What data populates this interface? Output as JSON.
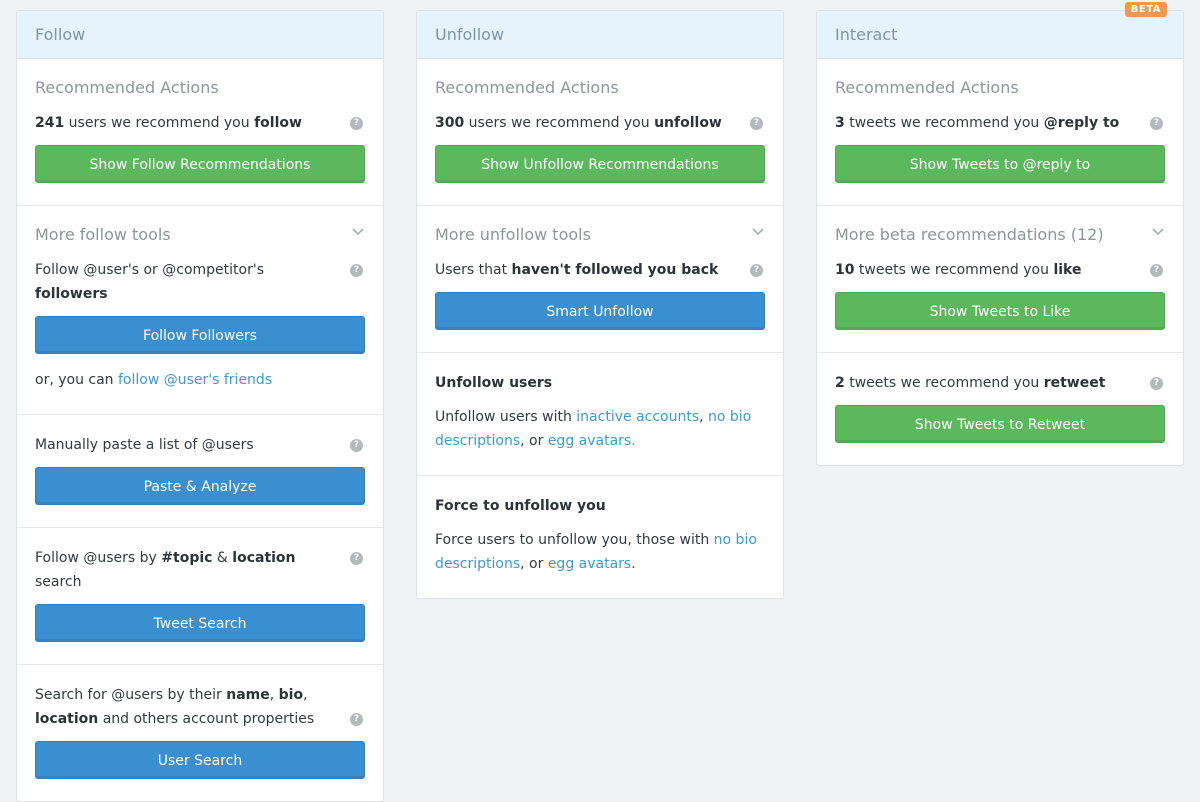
{
  "follow": {
    "header": "Follow",
    "recommended_title": "Recommended Actions",
    "rec_count": "241",
    "rec_text": " users we recommend you ",
    "rec_bold": "follow",
    "rec_button": "Show Follow Recommendations",
    "more_title": "More follow tools",
    "followers_text": "Follow @user's or @competitor's ",
    "followers_bold": "followers",
    "followers_button": "Follow Followers",
    "friends_prefix": "or, you can ",
    "friends_link": "follow @user's friends",
    "paste_text": "Manually paste a list of @users",
    "paste_button": "Paste & Analyze",
    "topic_text_1": "Follow @users by ",
    "topic_bold_1": "#topic",
    "topic_text_2": " & ",
    "topic_bold_2": "location",
    "topic_text_3": " search",
    "topic_button": "Tweet Search",
    "search_text_1": "Search for @users by their ",
    "search_bold_1": "name",
    "search_text_2": ", ",
    "search_bold_2": "bio",
    "search_text_3": ", ",
    "search_bold_3": "location",
    "search_text_4": " and others account properties",
    "search_button": "User Search"
  },
  "unfollow": {
    "header": "Unfollow",
    "recommended_title": "Recommended Actions",
    "rec_count": "300",
    "rec_text": " users we recommend you ",
    "rec_bold": "unfollow",
    "rec_button": "Show Unfollow Recommendations",
    "more_title": "More unfollow tools",
    "back_text": "Users that ",
    "back_bold": "haven't followed you back",
    "back_button": "Smart Unfollow",
    "users_title": "Unfollow users",
    "users_text_1": "Unfollow users with ",
    "users_link_1": "inactive accounts",
    "users_text_2": ", ",
    "users_link_2": "no bio descriptions",
    "users_text_3": ", or ",
    "users_link_3": "egg avatars.",
    "force_title": "Force to unfollow you",
    "force_text_1": "Force users to unfollow you, those with ",
    "force_link_1": "no bio descriptions",
    "force_text_2": ", or ",
    "force_link_2": "egg avatars",
    "force_text_3": "."
  },
  "interact": {
    "header": "Interact",
    "badge": "BETA",
    "recommended_title": "Recommended Actions",
    "rec_count": "3",
    "rec_text": " tweets we recommend you ",
    "rec_bold": "@reply to",
    "rec_button": "Show Tweets to @reply to",
    "more_title": "More beta recommendations (12)",
    "like_count": "10",
    "like_text": " tweets we recommend you ",
    "like_bold": "like",
    "like_button": "Show Tweets to Like",
    "retweet_count": "2",
    "retweet_text": " tweets we recommend you ",
    "retweet_bold": "retweet",
    "retweet_button": "Show Tweets to Retweet"
  },
  "icons": {
    "help": "question-circle-icon",
    "chevron": "chevron-down-icon"
  },
  "colors": {
    "green": "#5cb85c",
    "blue": "#3a8fd0",
    "link": "#3a9ad9",
    "badge": "#f0984e",
    "header_bg": "#e6f3fd"
  }
}
